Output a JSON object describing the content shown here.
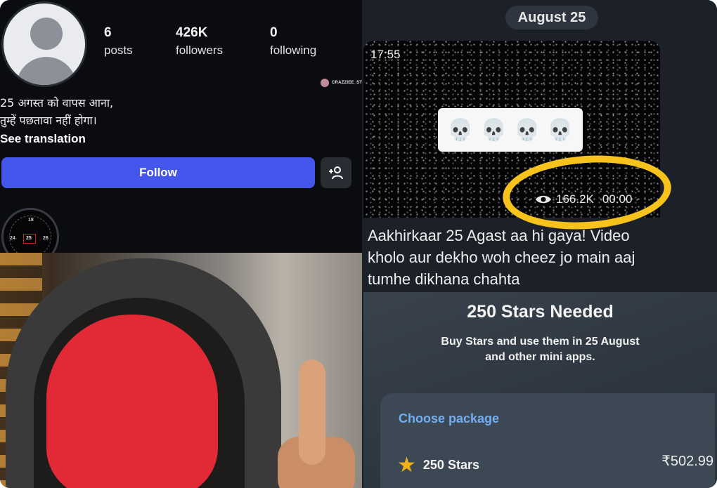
{
  "profile": {
    "stats": [
      {
        "value": "6",
        "label": "posts"
      },
      {
        "value": "426K",
        "label": "followers"
      },
      {
        "value": "0",
        "label": "following"
      }
    ],
    "watermark": "CRAZZIEE_STUFF",
    "bio_lines": [
      "25 अगस्त को वापस आना,",
      "तुम्हें पछतावा नहीं होगा।"
    ],
    "see_translation": "See translation",
    "follow_label": "Follow",
    "add_user_icon": "add-person-icon",
    "highlight_numbers": [
      "18",
      "24",
      "25",
      "26"
    ]
  },
  "chat": {
    "date": "August 25",
    "video": {
      "time": "17:55",
      "emoji": [
        "💀",
        "💀",
        "💀",
        "💀"
      ],
      "views": "166.2K",
      "duration": "00:00"
    },
    "message": "Aakhirkaar 25 Agast aa hi gaya! Video kholo aur dekho woh cheez jo main aaj tumhe dikhana chahta",
    "stars_title": "250 Stars Needed",
    "stars_desc": "Buy Stars and use them in 25 August and other mini apps.",
    "choose_package": "Choose package",
    "package": {
      "name": "250 Stars",
      "price": "₹502.99"
    }
  },
  "colors": {
    "follow": "#4456ec",
    "annotation": "#f6c21b",
    "link": "#73aef0",
    "star": "#f1b11b",
    "mask": "#e12a35"
  }
}
